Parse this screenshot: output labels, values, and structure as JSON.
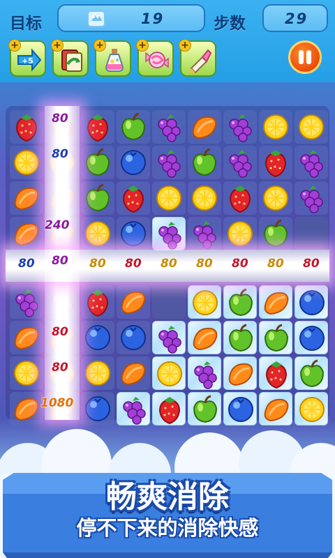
{
  "hud": {
    "target_label": "目标",
    "target_value": "19",
    "target_icon": "ice-block-icon",
    "steps_label": "步数",
    "steps_value": "29"
  },
  "tools": [
    {
      "name": "plus-five-moves-tool",
      "icon": "plus-five-arrow-icon",
      "text": "+5"
    },
    {
      "name": "shuffle-tool",
      "icon": "shuffle-card-icon"
    },
    {
      "name": "potion-tool",
      "icon": "potion-bottle-icon"
    },
    {
      "name": "candy-tool",
      "icon": "candy-icon"
    },
    {
      "name": "brush-tool",
      "icon": "brush-icon"
    }
  ],
  "pause_icon": "pause-icon",
  "colors": {
    "hud_bg": "#249fe6",
    "label": "#0b3f7c",
    "banner": "#3a7fe0",
    "title_stroke": "#1b4ba8"
  },
  "board": {
    "rows": [
      [
        "strawberry",
        "strawberry",
        "strawberry",
        "apple",
        "grape",
        "orange",
        "grape",
        "lemon",
        "lemon"
      ],
      [
        "lemon",
        "lemon",
        "apple",
        "blueberry",
        "grape",
        "apple",
        "grape",
        "strawberry",
        "grape"
      ],
      [
        "orange",
        "orange",
        "apple",
        "strawberry",
        "lemon",
        "lemon",
        "strawberry",
        "lemon",
        "grape"
      ],
      [
        "orange",
        "orange",
        "lemon",
        "blueberry",
        "grape",
        "grape",
        "lemon",
        "apple",
        "empty"
      ],
      [
        "grape",
        "grape",
        "strawberry",
        "orange",
        "empty",
        "lemon",
        "apple",
        "orange",
        "blueberry"
      ],
      [
        "orange",
        "orange",
        "blueberry",
        "blueberry",
        "grape",
        "orange",
        "apple",
        "apple",
        "blueberry"
      ],
      [
        "lemon",
        "lemon",
        "lemon",
        "orange",
        "lemon",
        "grape",
        "orange",
        "strawberry",
        "apple"
      ],
      [
        "orange",
        "orange",
        "blueberry",
        "grape",
        "strawberry",
        "apple",
        "blueberry",
        "orange",
        "lemon"
      ]
    ],
    "ice_cells": [
      [
        3,
        4
      ],
      [
        4,
        5
      ],
      [
        4,
        6
      ],
      [
        4,
        7
      ],
      [
        4,
        8
      ],
      [
        5,
        4
      ],
      [
        5,
        5
      ],
      [
        5,
        6
      ],
      [
        5,
        7
      ],
      [
        5,
        8
      ],
      [
        6,
        4
      ],
      [
        6,
        5
      ],
      [
        6,
        6
      ],
      [
        6,
        7
      ],
      [
        6,
        8
      ],
      [
        7,
        3
      ],
      [
        7,
        4
      ],
      [
        7,
        5
      ],
      [
        7,
        6
      ],
      [
        7,
        7
      ],
      [
        7,
        8
      ]
    ],
    "score_popups_column": [
      {
        "text": "80",
        "color": "purple",
        "row": 0
      },
      {
        "text": "80",
        "color": "blue",
        "row": 1
      },
      {
        "text": "240",
        "color": "purple",
        "row": 3
      },
      {
        "text": "80",
        "color": "purple",
        "row": 4
      },
      {
        "text": "80",
        "color": "red",
        "row": 6
      },
      {
        "text": "80",
        "color": "red",
        "row": 7
      },
      {
        "text": "1080",
        "color": "orange",
        "row": 8
      }
    ],
    "score_popups_row": [
      {
        "text": "80",
        "color": "blue",
        "col": 0
      },
      {
        "text": "80",
        "color": "gold",
        "col": 2
      },
      {
        "text": "80",
        "color": "red",
        "col": 3
      },
      {
        "text": "80",
        "color": "gold",
        "col": 4
      },
      {
        "text": "80",
        "color": "gold",
        "col": 5
      },
      {
        "text": "80",
        "color": "red",
        "col": 6
      },
      {
        "text": "80",
        "color": "gold",
        "col": 7
      },
      {
        "text": "80",
        "color": "red",
        "col": 8
      }
    ]
  },
  "banner": {
    "title": "畅爽消除",
    "subtitle": "停不下来的消除快感"
  }
}
